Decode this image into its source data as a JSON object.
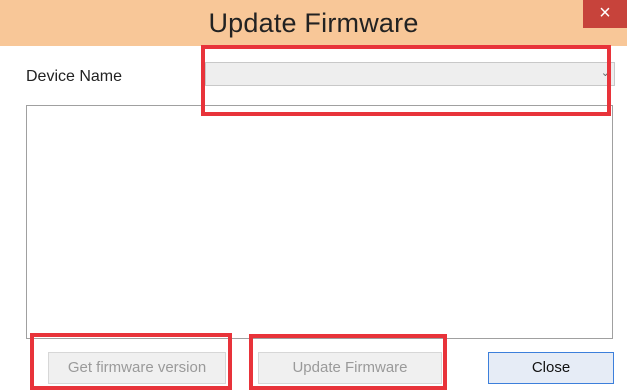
{
  "window": {
    "title": "Update Firmware",
    "close_glyph": "×"
  },
  "form": {
    "device_label": "Device Name",
    "device_selected": "",
    "dropdown_icon": "chevron-down-icon"
  },
  "output": {
    "text": ""
  },
  "buttons": {
    "get_version": "Get firmware version",
    "update": "Update Firmware",
    "close": "Close"
  },
  "colors": {
    "titlebar": "#f8c798",
    "close_button": "#c7433b",
    "highlight": "#e8333a",
    "focus_border": "#3c7fdb"
  }
}
